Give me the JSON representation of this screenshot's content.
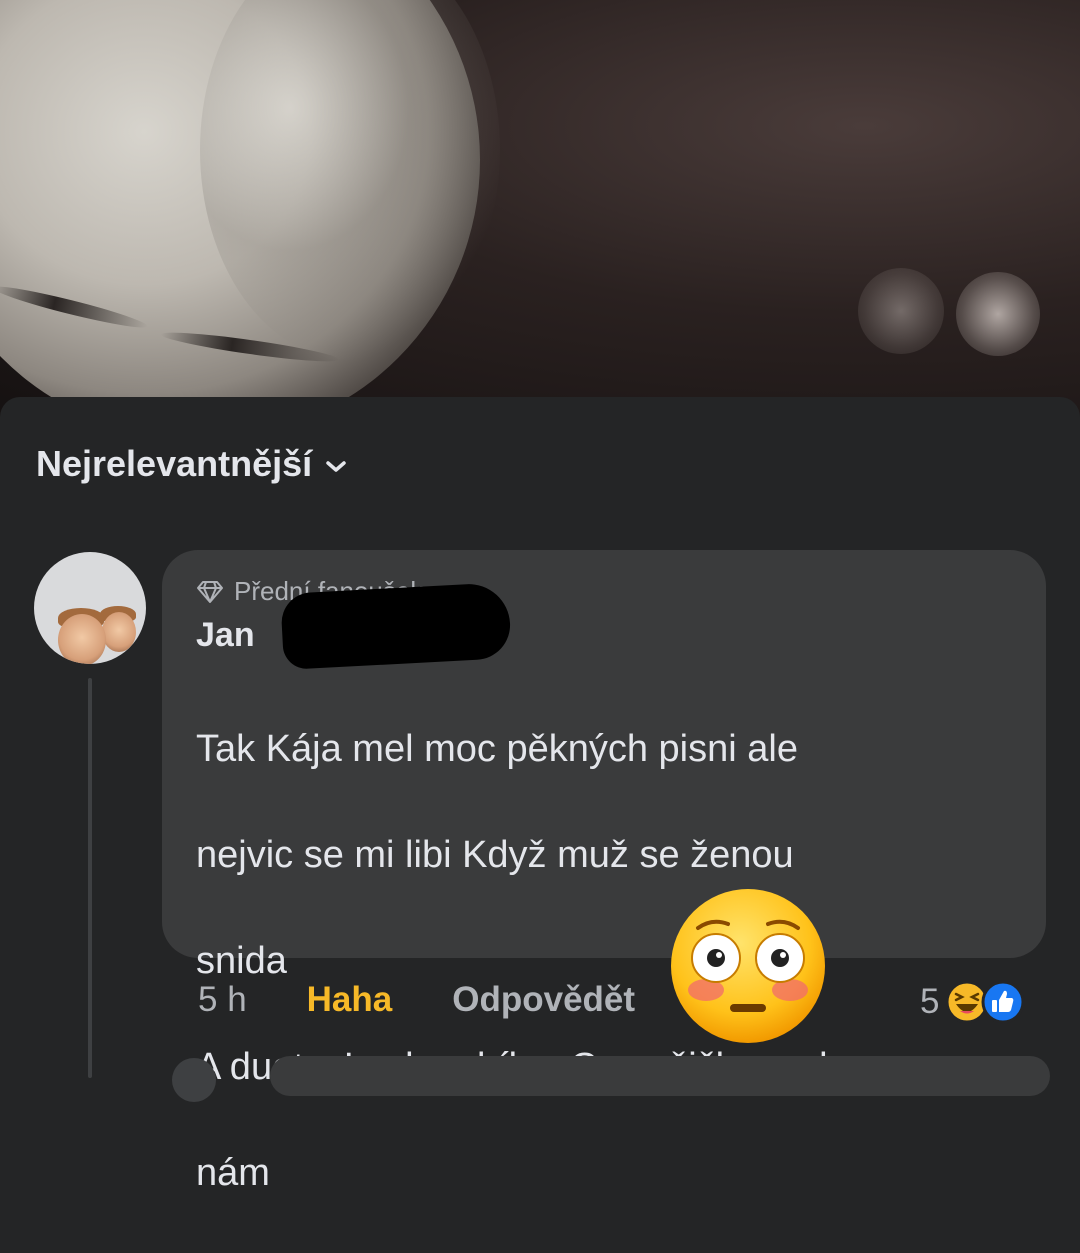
{
  "sort": {
    "label": "Nejrelevantnější"
  },
  "comment": {
    "badge": "Přední fanoušek",
    "author": "Jan",
    "text_lines": [
      "Tak Kája mel moc pěkných pisni ale",
      "nejvic se mi libi Když muž se ženou",
      "snida",
      "A duet s Luckou bílou Co sušičky praly",
      "nám"
    ],
    "time": "5 h",
    "reaction_label": "Haha",
    "reply_label": "Odpovědět",
    "reaction_count": "5",
    "reaction_icons": [
      "haha-icon",
      "like-icon"
    ]
  },
  "overlay": {
    "sticker": "flushed-face-emoji"
  },
  "colors": {
    "background": "#242526",
    "bubble": "#3a3b3c",
    "text": "#e4e6eb",
    "secondary_text": "#b0b3b8",
    "haha_accent": "#f7b928",
    "like_blue": "#1877f2"
  }
}
